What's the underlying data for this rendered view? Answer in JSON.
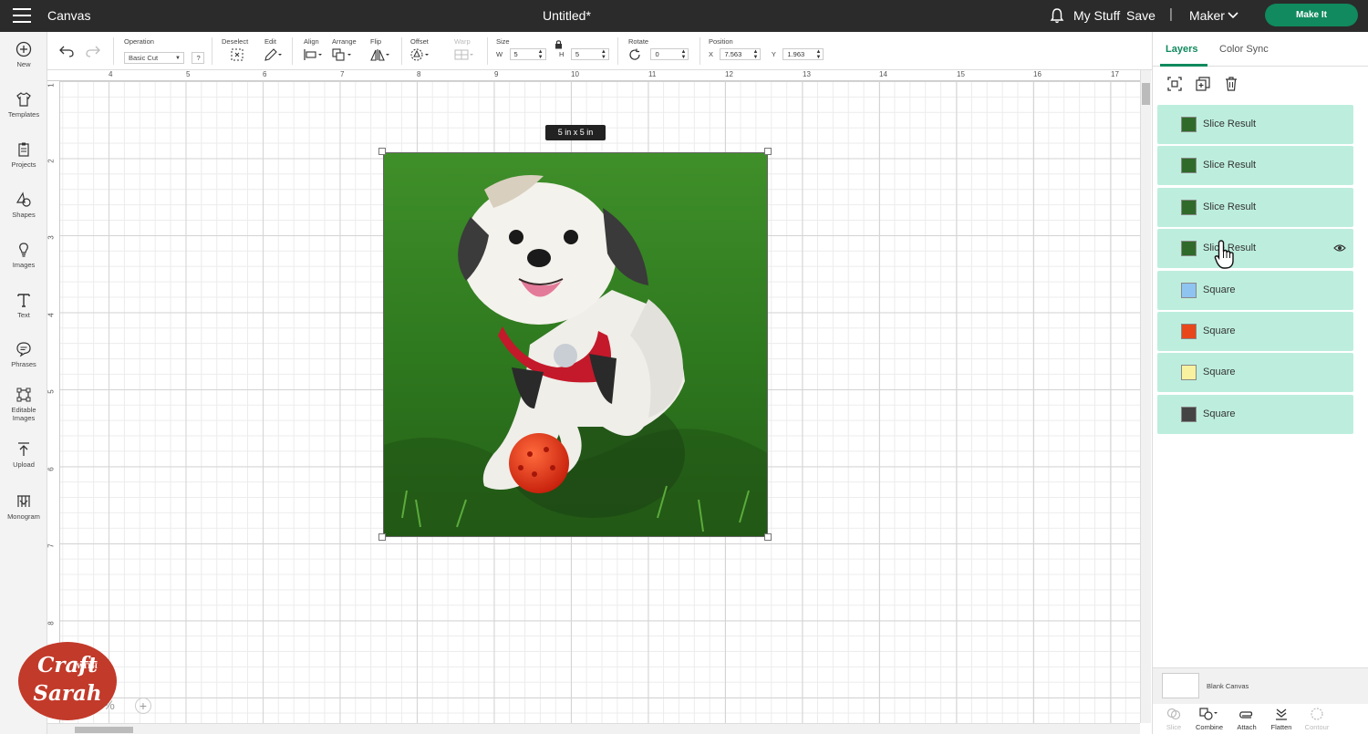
{
  "topbar": {
    "app_title": "Canvas",
    "document_title": "Untitled*",
    "my_stuff": "My Stuff",
    "save": "Save",
    "separator": "|",
    "machine": "Maker",
    "make_it": "Make It"
  },
  "leftbar": {
    "items": [
      {
        "label": "New",
        "icon": "plus-circle-icon"
      },
      {
        "label": "Templates",
        "icon": "shirt-icon"
      },
      {
        "label": "Projects",
        "icon": "clipboard-icon"
      },
      {
        "label": "Shapes",
        "icon": "shapes-icon"
      },
      {
        "label": "Images",
        "icon": "lightbulb-icon"
      },
      {
        "label": "Text",
        "icon": "text-icon"
      },
      {
        "label": "Phrases",
        "icon": "speech-bubble-icon"
      },
      {
        "label": "Editable Images",
        "icon": "editable-image-icon"
      },
      {
        "label": "Upload",
        "icon": "upload-icon"
      },
      {
        "label": "Monogram",
        "icon": "monogram-icon"
      }
    ]
  },
  "toolbar": {
    "operation_label": "Operation",
    "operation_value": "Basic Cut",
    "help": "?",
    "deselect": "Deselect",
    "edit": "Edit",
    "align": "Align",
    "arrange": "Arrange",
    "flip": "Flip",
    "offset": "Offset",
    "warp": "Warp",
    "size_label": "Size",
    "w_label": "W",
    "w_value": "5",
    "h_label": "H",
    "h_value": "5",
    "rotate_label": "Rotate",
    "rotate_value": "0",
    "position_label": "Position",
    "x_label": "X",
    "x_value": "7.563",
    "y_label": "Y",
    "y_value": "1.963"
  },
  "canvas": {
    "ruler_h": [
      "4",
      "5",
      "6",
      "7",
      "8",
      "9",
      "10",
      "11",
      "12",
      "13",
      "14",
      "15",
      "16",
      "17"
    ],
    "ruler_v": [
      "2",
      "3",
      "4",
      "5",
      "6",
      "7",
      "8"
    ],
    "ruler_v_top": "1",
    "size_tag": "5  in x 5  in",
    "zoom": "100%",
    "zoom_plus": "+"
  },
  "watermark": {
    "line1": "Craft",
    "line2": "WITH",
    "line3": "Sarah"
  },
  "layers_panel": {
    "tabs": [
      "Layers",
      "Color Sync"
    ],
    "layers": [
      {
        "name": "Slice Result",
        "type": "image"
      },
      {
        "name": "Slice Result",
        "type": "image"
      },
      {
        "name": "Slice Result",
        "type": "image"
      },
      {
        "name": "Slice Result",
        "type": "image",
        "hovered": true
      },
      {
        "name": "Square",
        "color": "#8fc3f0"
      },
      {
        "name": "Square",
        "color": "#e8471c"
      },
      {
        "name": "Square",
        "color": "#f7f1a0"
      },
      {
        "name": "Square",
        "color": "#444444"
      }
    ],
    "blank_canvas": "Blank Canvas",
    "actions": [
      {
        "label": "Slice",
        "enabled": false
      },
      {
        "label": "Combine",
        "enabled": true
      },
      {
        "label": "Attach",
        "enabled": true
      },
      {
        "label": "Flatten",
        "enabled": true
      },
      {
        "label": "Contour",
        "enabled": false
      }
    ]
  },
  "colors": {
    "accent": "#108a5e",
    "topbar": "#2b2b2b",
    "layer_bg": "#bdeedd"
  }
}
